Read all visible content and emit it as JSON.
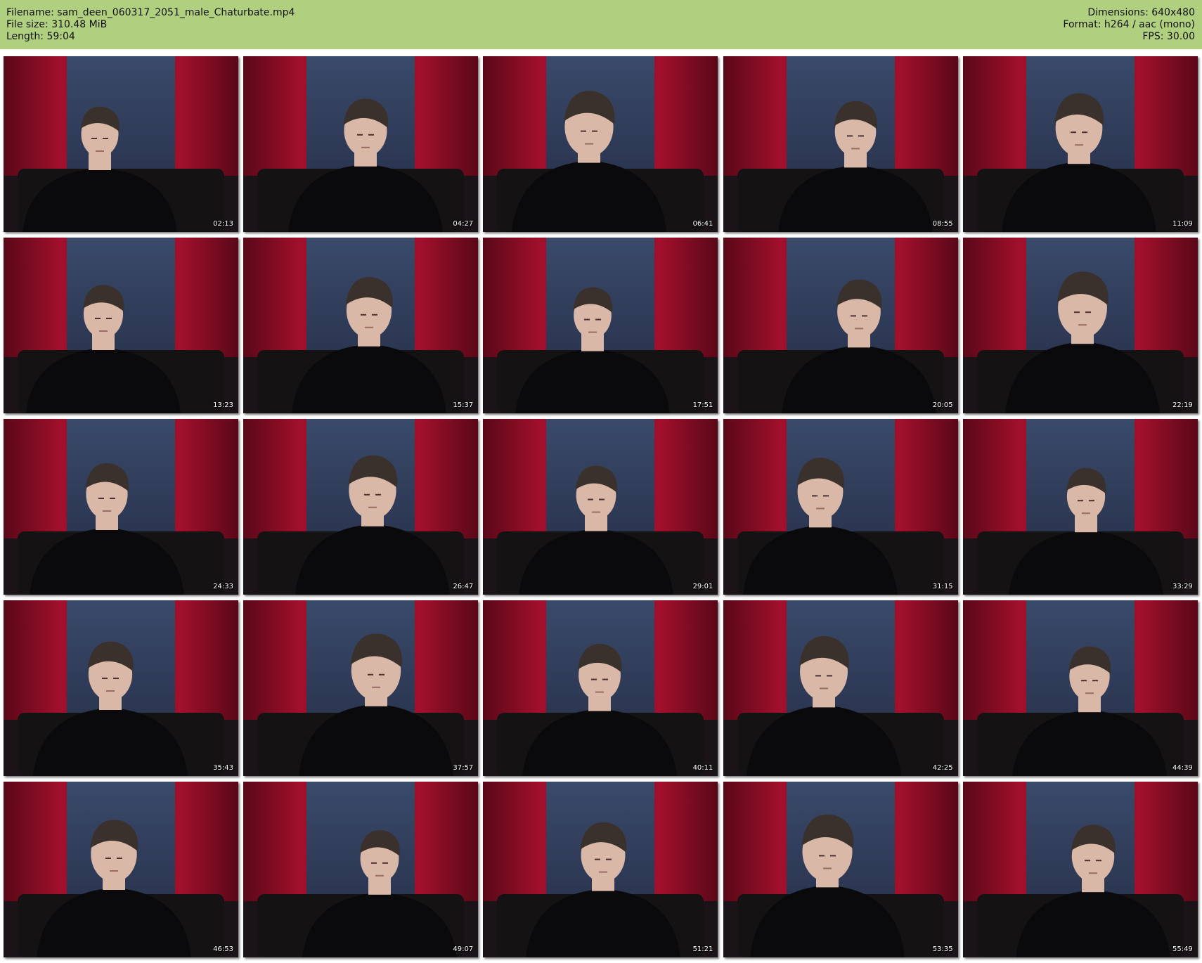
{
  "header": {
    "filename_label": "Filename: sam_deen_060317_2051_male_Chaturbate.mp4",
    "filesize_label": "File size: 310.48 MiB",
    "length_label": "Length: 59:04",
    "dimensions_label": "Dimensions: 640x480",
    "format_label": "Format: h264 / aac (mono)",
    "fps_label": "FPS: 30.00"
  },
  "colors": {
    "header_bg": "#b0d080",
    "curtain": "#a3102c",
    "curtain_dark": "#5a0818",
    "wall": "#2a3550",
    "sweater": "#0a0a0c",
    "skin": "#d9b8a8",
    "hair": "#3a302c"
  },
  "thumbnails": [
    {
      "time": "02:13"
    },
    {
      "time": "04:27"
    },
    {
      "time": "06:41"
    },
    {
      "time": "08:55"
    },
    {
      "time": "11:09"
    },
    {
      "time": "13:23"
    },
    {
      "time": "15:37"
    },
    {
      "time": "17:51"
    },
    {
      "time": "20:05"
    },
    {
      "time": "22:19"
    },
    {
      "time": "24:33"
    },
    {
      "time": "26:47"
    },
    {
      "time": "29:01"
    },
    {
      "time": "31:15"
    },
    {
      "time": "33:29"
    },
    {
      "time": "35:43"
    },
    {
      "time": "37:57"
    },
    {
      "time": "40:11"
    },
    {
      "time": "42:25"
    },
    {
      "time": "44:39"
    },
    {
      "time": "46:53"
    },
    {
      "time": "49:07"
    },
    {
      "time": "51:21"
    },
    {
      "time": "53:35"
    },
    {
      "time": "55:49"
    }
  ]
}
